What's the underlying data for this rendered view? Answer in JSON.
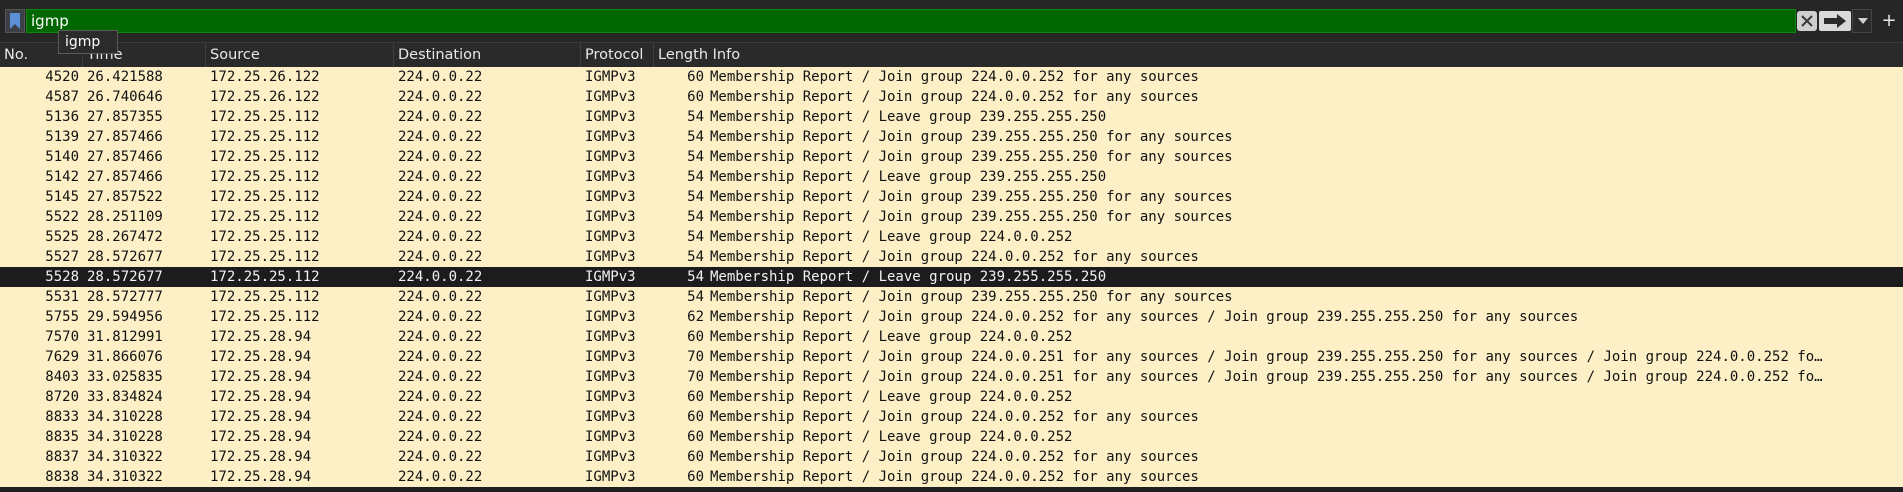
{
  "filter": {
    "value": "igmp",
    "suggestion": "igmp",
    "add_label": "+",
    "bg_color": "#006600"
  },
  "columns": {
    "no": "No.",
    "time": "Time",
    "source": "Source",
    "destination": "Destination",
    "protocol": "Protocol",
    "length_info": "Length Info"
  },
  "packets": [
    {
      "no": "4520",
      "time": "26.421588",
      "src": "172.25.26.122",
      "dst": "224.0.0.22",
      "proto": "IGMPv3",
      "len": "60",
      "info": "Membership Report / Join group 224.0.0.252 for any sources"
    },
    {
      "no": "4587",
      "time": "26.740646",
      "src": "172.25.26.122",
      "dst": "224.0.0.22",
      "proto": "IGMPv3",
      "len": "60",
      "info": "Membership Report / Join group 224.0.0.252 for any sources"
    },
    {
      "no": "5136",
      "time": "27.857355",
      "src": "172.25.25.112",
      "dst": "224.0.0.22",
      "proto": "IGMPv3",
      "len": "54",
      "info": "Membership Report / Leave group 239.255.255.250"
    },
    {
      "no": "5139",
      "time": "27.857466",
      "src": "172.25.25.112",
      "dst": "224.0.0.22",
      "proto": "IGMPv3",
      "len": "54",
      "info": "Membership Report / Join group 239.255.255.250 for any sources"
    },
    {
      "no": "5140",
      "time": "27.857466",
      "src": "172.25.25.112",
      "dst": "224.0.0.22",
      "proto": "IGMPv3",
      "len": "54",
      "info": "Membership Report / Join group 239.255.255.250 for any sources"
    },
    {
      "no": "5142",
      "time": "27.857466",
      "src": "172.25.25.112",
      "dst": "224.0.0.22",
      "proto": "IGMPv3",
      "len": "54",
      "info": "Membership Report / Leave group 239.255.255.250"
    },
    {
      "no": "5145",
      "time": "27.857522",
      "src": "172.25.25.112",
      "dst": "224.0.0.22",
      "proto": "IGMPv3",
      "len": "54",
      "info": "Membership Report / Join group 239.255.255.250 for any sources"
    },
    {
      "no": "5522",
      "time": "28.251109",
      "src": "172.25.25.112",
      "dst": "224.0.0.22",
      "proto": "IGMPv3",
      "len": "54",
      "info": "Membership Report / Join group 239.255.255.250 for any sources"
    },
    {
      "no": "5525",
      "time": "28.267472",
      "src": "172.25.25.112",
      "dst": "224.0.0.22",
      "proto": "IGMPv3",
      "len": "54",
      "info": "Membership Report / Leave group 224.0.0.252"
    },
    {
      "no": "5527",
      "time": "28.572677",
      "src": "172.25.25.112",
      "dst": "224.0.0.22",
      "proto": "IGMPv3",
      "len": "54",
      "info": "Membership Report / Join group 224.0.0.252 for any sources"
    },
    {
      "no": "5528",
      "time": "28.572677",
      "src": "172.25.25.112",
      "dst": "224.0.0.22",
      "proto": "IGMPv3",
      "len": "54",
      "info": "Membership Report / Leave group 239.255.255.250",
      "selected": true
    },
    {
      "no": "5531",
      "time": "28.572777",
      "src": "172.25.25.112",
      "dst": "224.0.0.22",
      "proto": "IGMPv3",
      "len": "54",
      "info": "Membership Report / Join group 239.255.255.250 for any sources"
    },
    {
      "no": "5755",
      "time": "29.594956",
      "src": "172.25.25.112",
      "dst": "224.0.0.22",
      "proto": "IGMPv3",
      "len": "62",
      "info": "Membership Report / Join group 224.0.0.252 for any sources / Join group 239.255.255.250 for any sources"
    },
    {
      "no": "7570",
      "time": "31.812991",
      "src": "172.25.28.94",
      "dst": "224.0.0.22",
      "proto": "IGMPv3",
      "len": "60",
      "info": "Membership Report / Leave group 224.0.0.252"
    },
    {
      "no": "7629",
      "time": "31.866076",
      "src": "172.25.28.94",
      "dst": "224.0.0.22",
      "proto": "IGMPv3",
      "len": "70",
      "info": "Membership Report / Join group 224.0.0.251 for any sources / Join group 239.255.255.250 for any sources / Join group 224.0.0.252 fo…"
    },
    {
      "no": "8403",
      "time": "33.025835",
      "src": "172.25.28.94",
      "dst": "224.0.0.22",
      "proto": "IGMPv3",
      "len": "70",
      "info": "Membership Report / Join group 224.0.0.251 for any sources / Join group 239.255.255.250 for any sources / Join group 224.0.0.252 fo…"
    },
    {
      "no": "8720",
      "time": "33.834824",
      "src": "172.25.28.94",
      "dst": "224.0.0.22",
      "proto": "IGMPv3",
      "len": "60",
      "info": "Membership Report / Leave group 224.0.0.252"
    },
    {
      "no": "8833",
      "time": "34.310228",
      "src": "172.25.28.94",
      "dst": "224.0.0.22",
      "proto": "IGMPv3",
      "len": "60",
      "info": "Membership Report / Join group 224.0.0.252 for any sources"
    },
    {
      "no": "8835",
      "time": "34.310228",
      "src": "172.25.28.94",
      "dst": "224.0.0.22",
      "proto": "IGMPv3",
      "len": "60",
      "info": "Membership Report / Leave group 224.0.0.252"
    },
    {
      "no": "8837",
      "time": "34.310322",
      "src": "172.25.28.94",
      "dst": "224.0.0.22",
      "proto": "IGMPv3",
      "len": "60",
      "info": "Membership Report / Join group 224.0.0.252 for any sources"
    },
    {
      "no": "8838",
      "time": "34.310322",
      "src": "172.25.28.94",
      "dst": "224.0.0.22",
      "proto": "IGMPv3",
      "len": "60",
      "info": "Membership Report / Join group 224.0.0.252 for any sources"
    }
  ],
  "colors": {
    "row_bg": "#fdf0c7",
    "selected_bg": "#1c1c1c"
  }
}
